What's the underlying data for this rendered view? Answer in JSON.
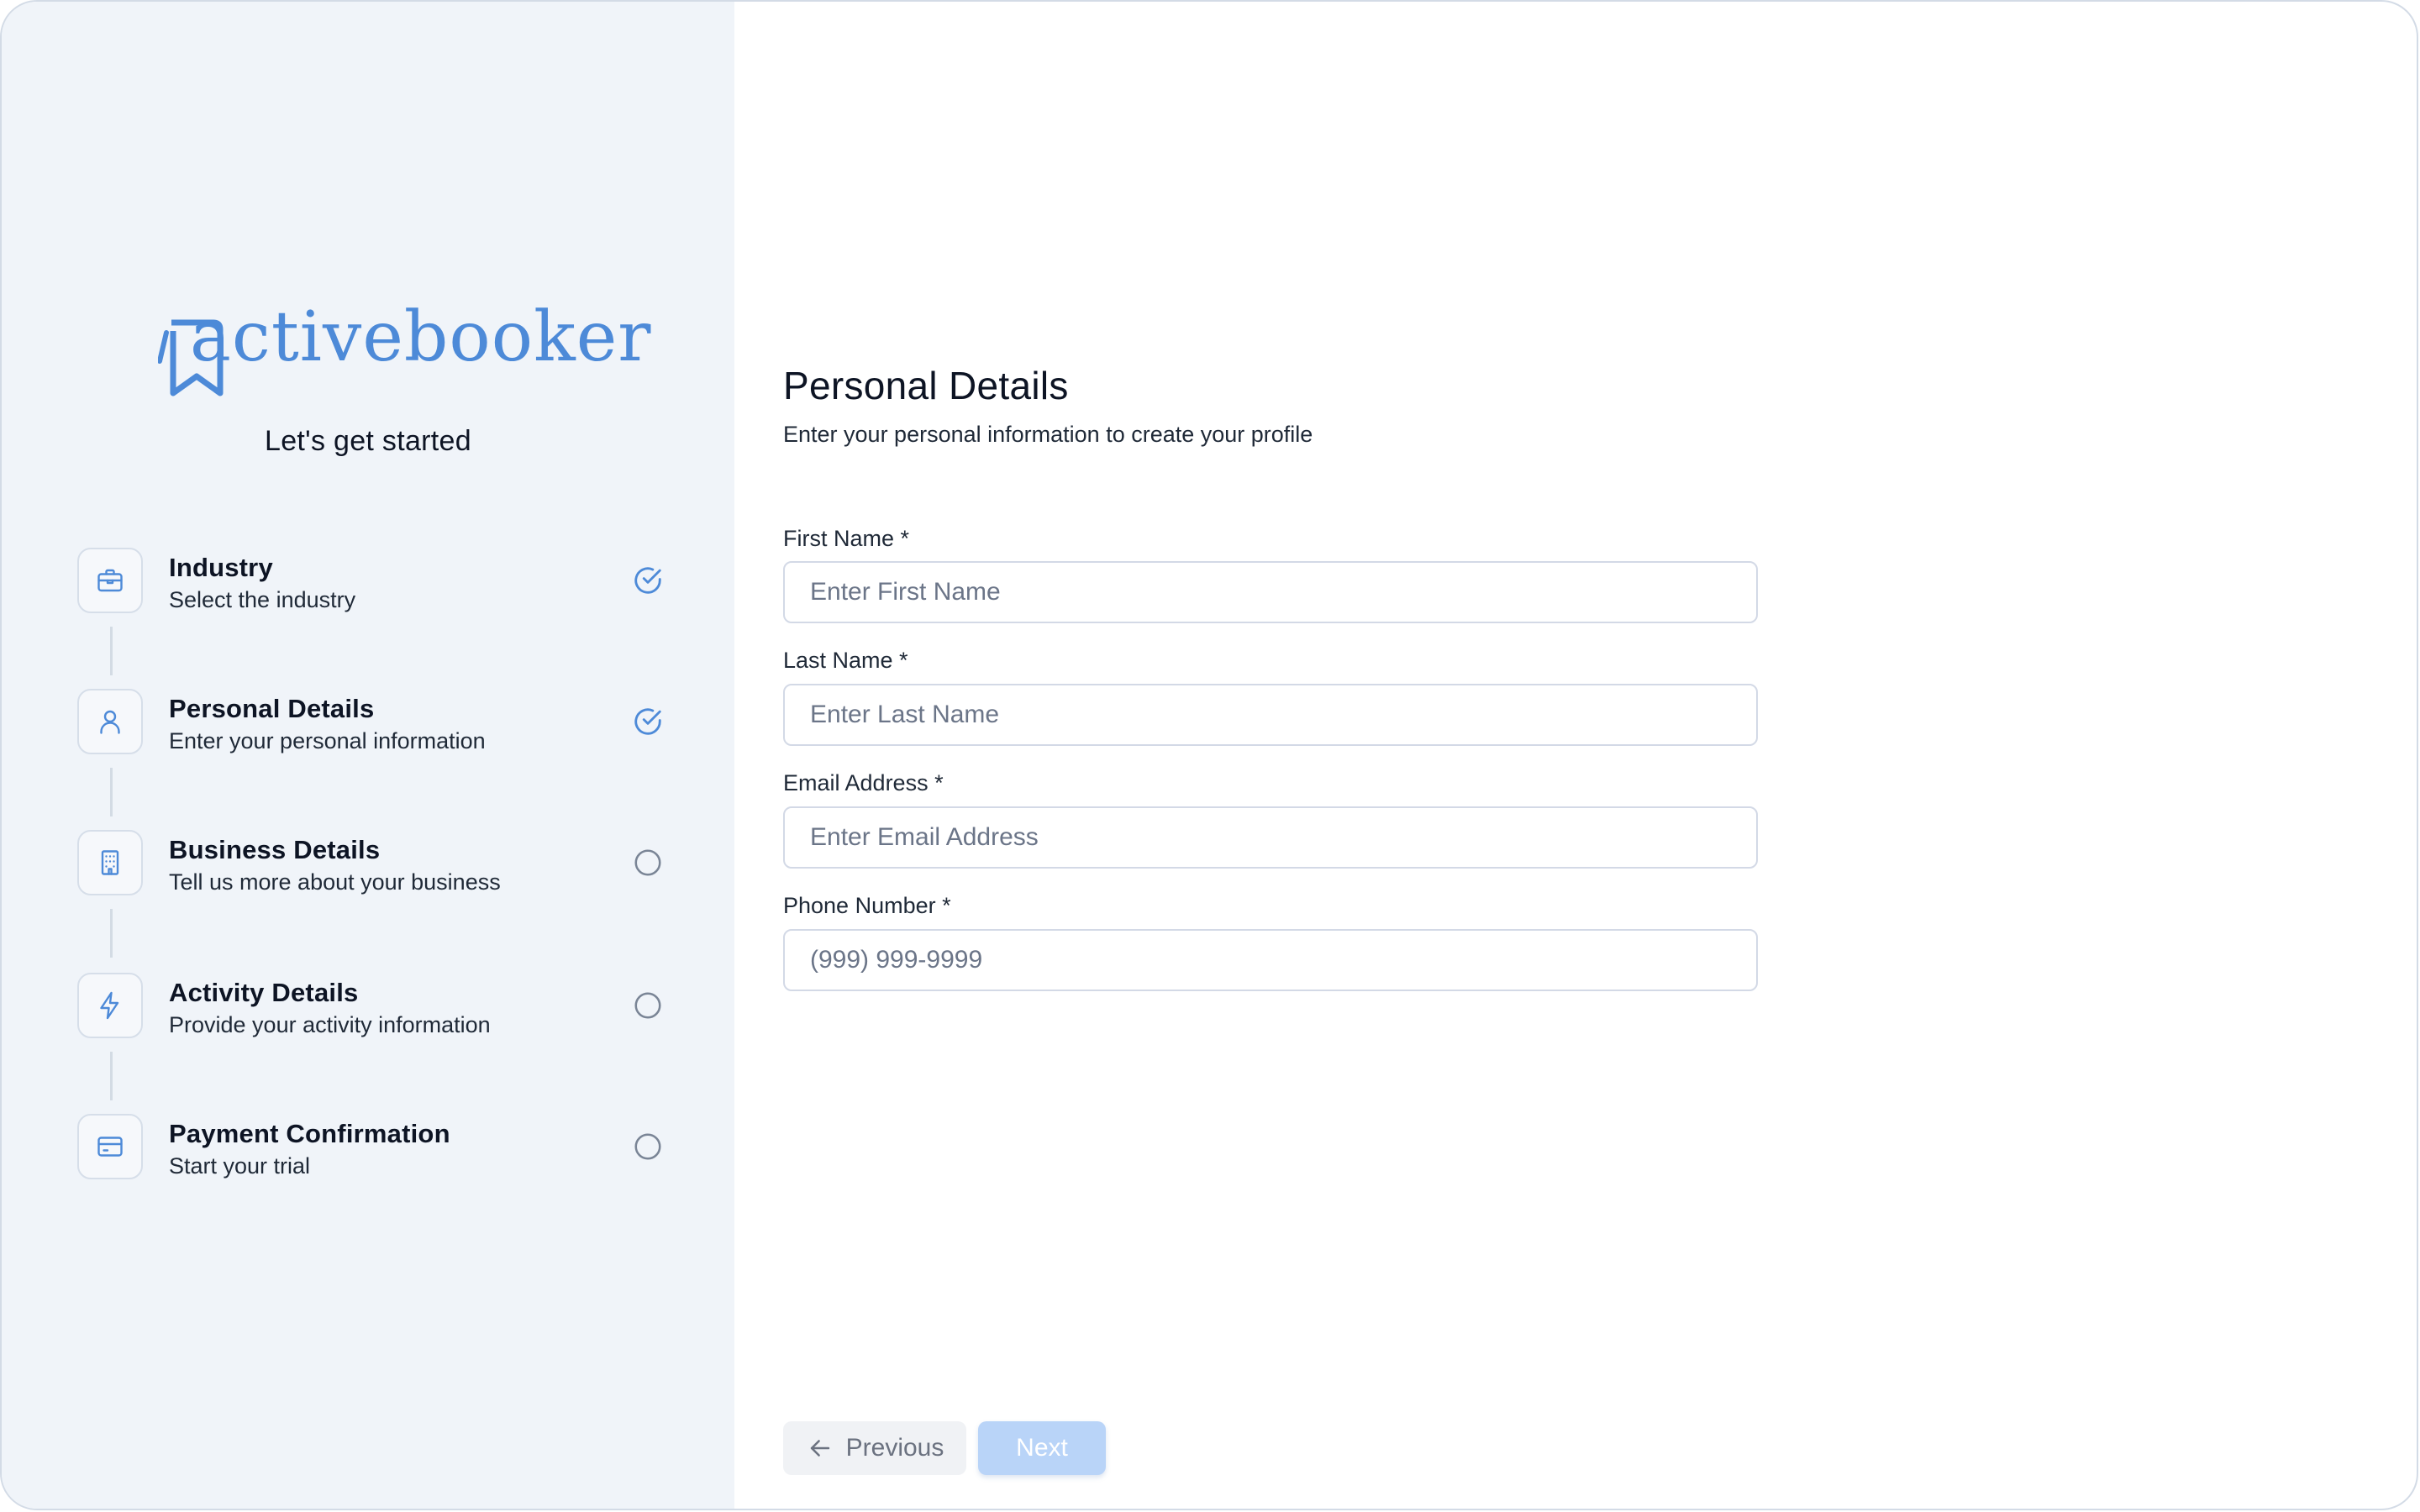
{
  "brand": {
    "name": "activebooker",
    "tagline": "Let's get started",
    "accent_color": "#4d8ad8"
  },
  "steps": [
    {
      "title": "Industry",
      "subtitle": "Select the industry",
      "icon": "briefcase-icon",
      "status": "completed"
    },
    {
      "title": "Personal Details",
      "subtitle": "Enter your personal information",
      "icon": "user-icon",
      "status": "completed"
    },
    {
      "title": "Business Details",
      "subtitle": "Tell us more about your business",
      "icon": "building-icon",
      "status": "pending"
    },
    {
      "title": "Activity Details",
      "subtitle": "Provide your activity information",
      "icon": "lightning-icon",
      "status": "pending"
    },
    {
      "title": "Payment Confirmation",
      "subtitle": "Start your trial",
      "icon": "credit-card-icon",
      "status": "pending"
    }
  ],
  "form": {
    "title": "Personal Details",
    "subtitle": "Enter your personal information to create your profile",
    "fields": [
      {
        "label": "First Name *",
        "placeholder": "Enter First Name",
        "value": ""
      },
      {
        "label": "Last Name *",
        "placeholder": "Enter Last Name",
        "value": ""
      },
      {
        "label": "Email Address *",
        "placeholder": "Enter Email Address",
        "value": ""
      },
      {
        "label": "Phone Number *",
        "placeholder": "(999) 999-9999",
        "value": ""
      }
    ]
  },
  "actions": {
    "previous_label": "Previous",
    "next_label": "Next",
    "next_disabled": true
  }
}
